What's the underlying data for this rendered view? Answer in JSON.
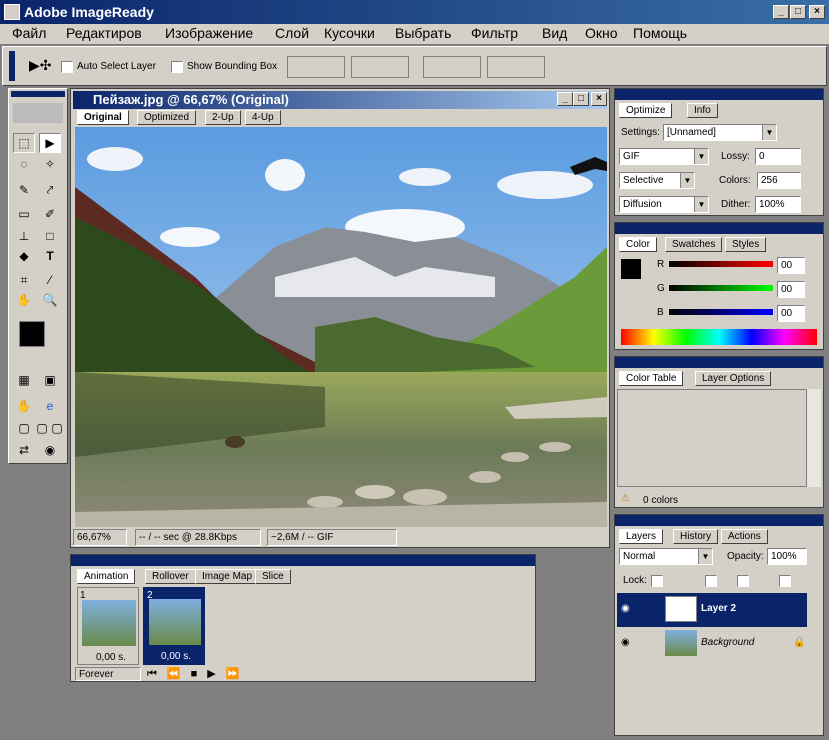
{
  "app": {
    "title": "Adobe ImageReady"
  },
  "menu": [
    "Файл",
    "Редактиров",
    "Изображение",
    "Слой",
    "Кусочки",
    "Выбрать",
    "Фильтр",
    "Вид",
    "Окно",
    "Помощь"
  ],
  "options_bar": {
    "auto_select": "Auto Select Layer",
    "bounding_box": "Show Bounding Box"
  },
  "document": {
    "title": "Пейзаж.jpg @ 66,67% (Original)",
    "tabs": [
      "Original",
      "Optimized",
      "2-Up",
      "4-Up"
    ],
    "status_zoom": "66,67%",
    "status_speed": "-- / -- sec @ 28.8Kbps",
    "status_size": "~2,6M / -- GIF"
  },
  "animation": {
    "tabs": [
      "Animation",
      "Rollover",
      "Image Map",
      "Slice"
    ],
    "frames": [
      {
        "num": "1",
        "delay": "0,00 s."
      },
      {
        "num": "2",
        "delay": "0,00 s."
      }
    ],
    "loop": "Forever"
  },
  "optimize": {
    "tabs": [
      "Optimize",
      "Info"
    ],
    "settings_label": "Settings:",
    "settings_value": "[Unnamed]",
    "format": "GIF",
    "lossy_label": "Lossy:",
    "lossy_value": "0",
    "palette": "Selective",
    "colors_label": "Colors:",
    "colors_value": "256",
    "dither_algo": "Diffusion",
    "dither_label": "Dither:",
    "dither_value": "100%"
  },
  "color_panel": {
    "tabs": [
      "Color",
      "Swatches",
      "Styles"
    ],
    "r_label": "R",
    "g_label": "G",
    "b_label": "B",
    "r_value": "00",
    "g_value": "00",
    "b_value": "00"
  },
  "color_table": {
    "tabs": [
      "Color Table",
      "Layer Options"
    ],
    "count": "0 colors"
  },
  "layers": {
    "tabs": [
      "Layers",
      "History",
      "Actions"
    ],
    "blend": "Normal",
    "opacity_label": "Opacity:",
    "opacity_value": "100%",
    "lock_label": "Lock:",
    "items": [
      {
        "name": "Layer 2"
      },
      {
        "name": "Background"
      }
    ]
  }
}
